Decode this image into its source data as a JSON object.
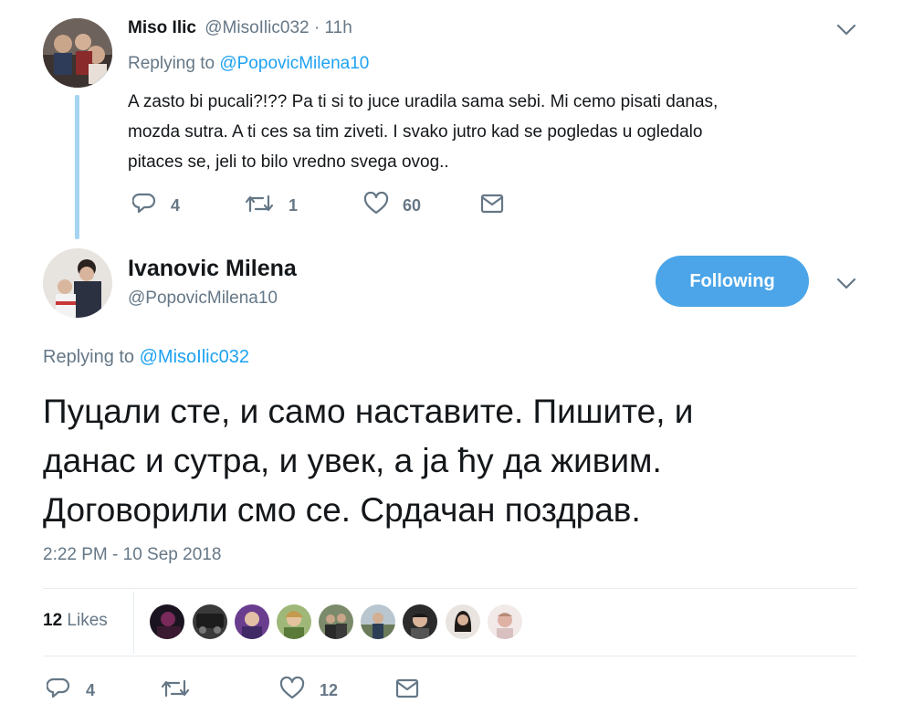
{
  "reply_tweet": {
    "display_name": "Miso Ilic",
    "handle": "@MisoIlic032",
    "separator": "·",
    "time_ago": "11h",
    "replying_prefix": "Replying to",
    "replying_to": "@PopovicMilena10",
    "text_lines": [
      "A zasto bi pucali?!?? Pa ti si to juce uradila sama sebi. Mi cemo pisati danas,",
      "mozda sutra. A ti ces sa tim ziveti. I svako jutro kad se pogledas u ogledalo",
      "pitaces se, jeli to bilo vredno svega ovog.."
    ],
    "reply_count": "4",
    "retweet_count": "1",
    "like_count": "60"
  },
  "main_tweet": {
    "display_name": "Ivanovic Milena",
    "handle": "@PopovicMilena10",
    "follow_label": "Following",
    "replying_prefix": "Replying to",
    "replying_to": "@MisoIlic032",
    "text_lines": [
      "Пуцали сте, и само наставите. Пишите, и",
      "данас и сутра, и увек, а ја ћу да живим.",
      "Договорили смо се. Срдачан поздрав."
    ],
    "timestamp": "2:22 PM - 10 Sep 2018",
    "likes_count": "12",
    "likes_label": "Likes",
    "reply_count": "4",
    "retweet_count": "",
    "like_count": "12"
  },
  "icons": {
    "reply": "reply-icon",
    "retweet": "retweet-icon",
    "like": "heart-icon",
    "dm": "envelope-icon",
    "menu": "chevron-down-icon"
  },
  "colors": {
    "accent": "#1da1f2",
    "follow_button": "#4ba5e8",
    "muted": "#657786",
    "thread_line": "#a6d4f2"
  }
}
